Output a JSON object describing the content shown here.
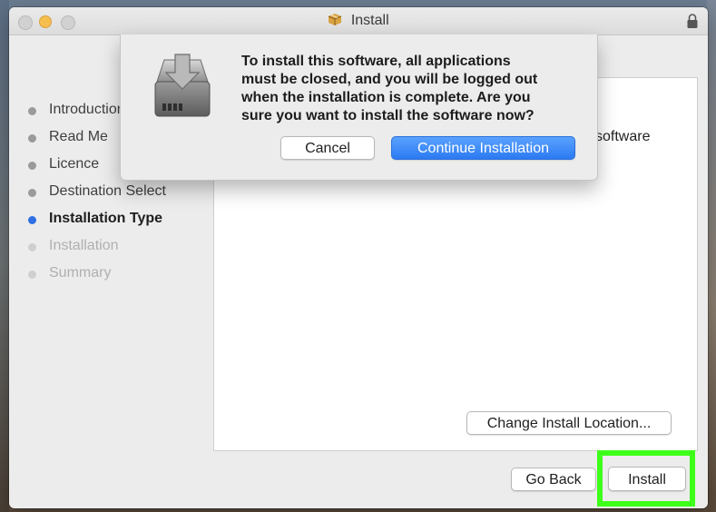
{
  "window": {
    "title": "Install"
  },
  "sidebar": {
    "steps": [
      {
        "label": "Introduction"
      },
      {
        "label": "Read Me"
      },
      {
        "label": "Licence"
      },
      {
        "label": "Destination Select"
      },
      {
        "label": "Installation Type",
        "state": "active"
      },
      {
        "label": "Installation",
        "state": "upcoming"
      },
      {
        "label": "Summary",
        "state": "upcoming"
      }
    ]
  },
  "content": {
    "visible_text": "software"
  },
  "buttons": {
    "change_location": "Change Install Location...",
    "go_back": "Go Back",
    "install": "Install"
  },
  "dialog": {
    "message": "To install this software, all applications\nmust be closed, and you will be logged out\nwhen the installation is complete. Are you\nsure you want to install the software now?",
    "cancel": "Cancel",
    "continue": "Continue Installation"
  },
  "colors": {
    "accent": "#2f6fe4",
    "highlight": "#3eff1a"
  }
}
